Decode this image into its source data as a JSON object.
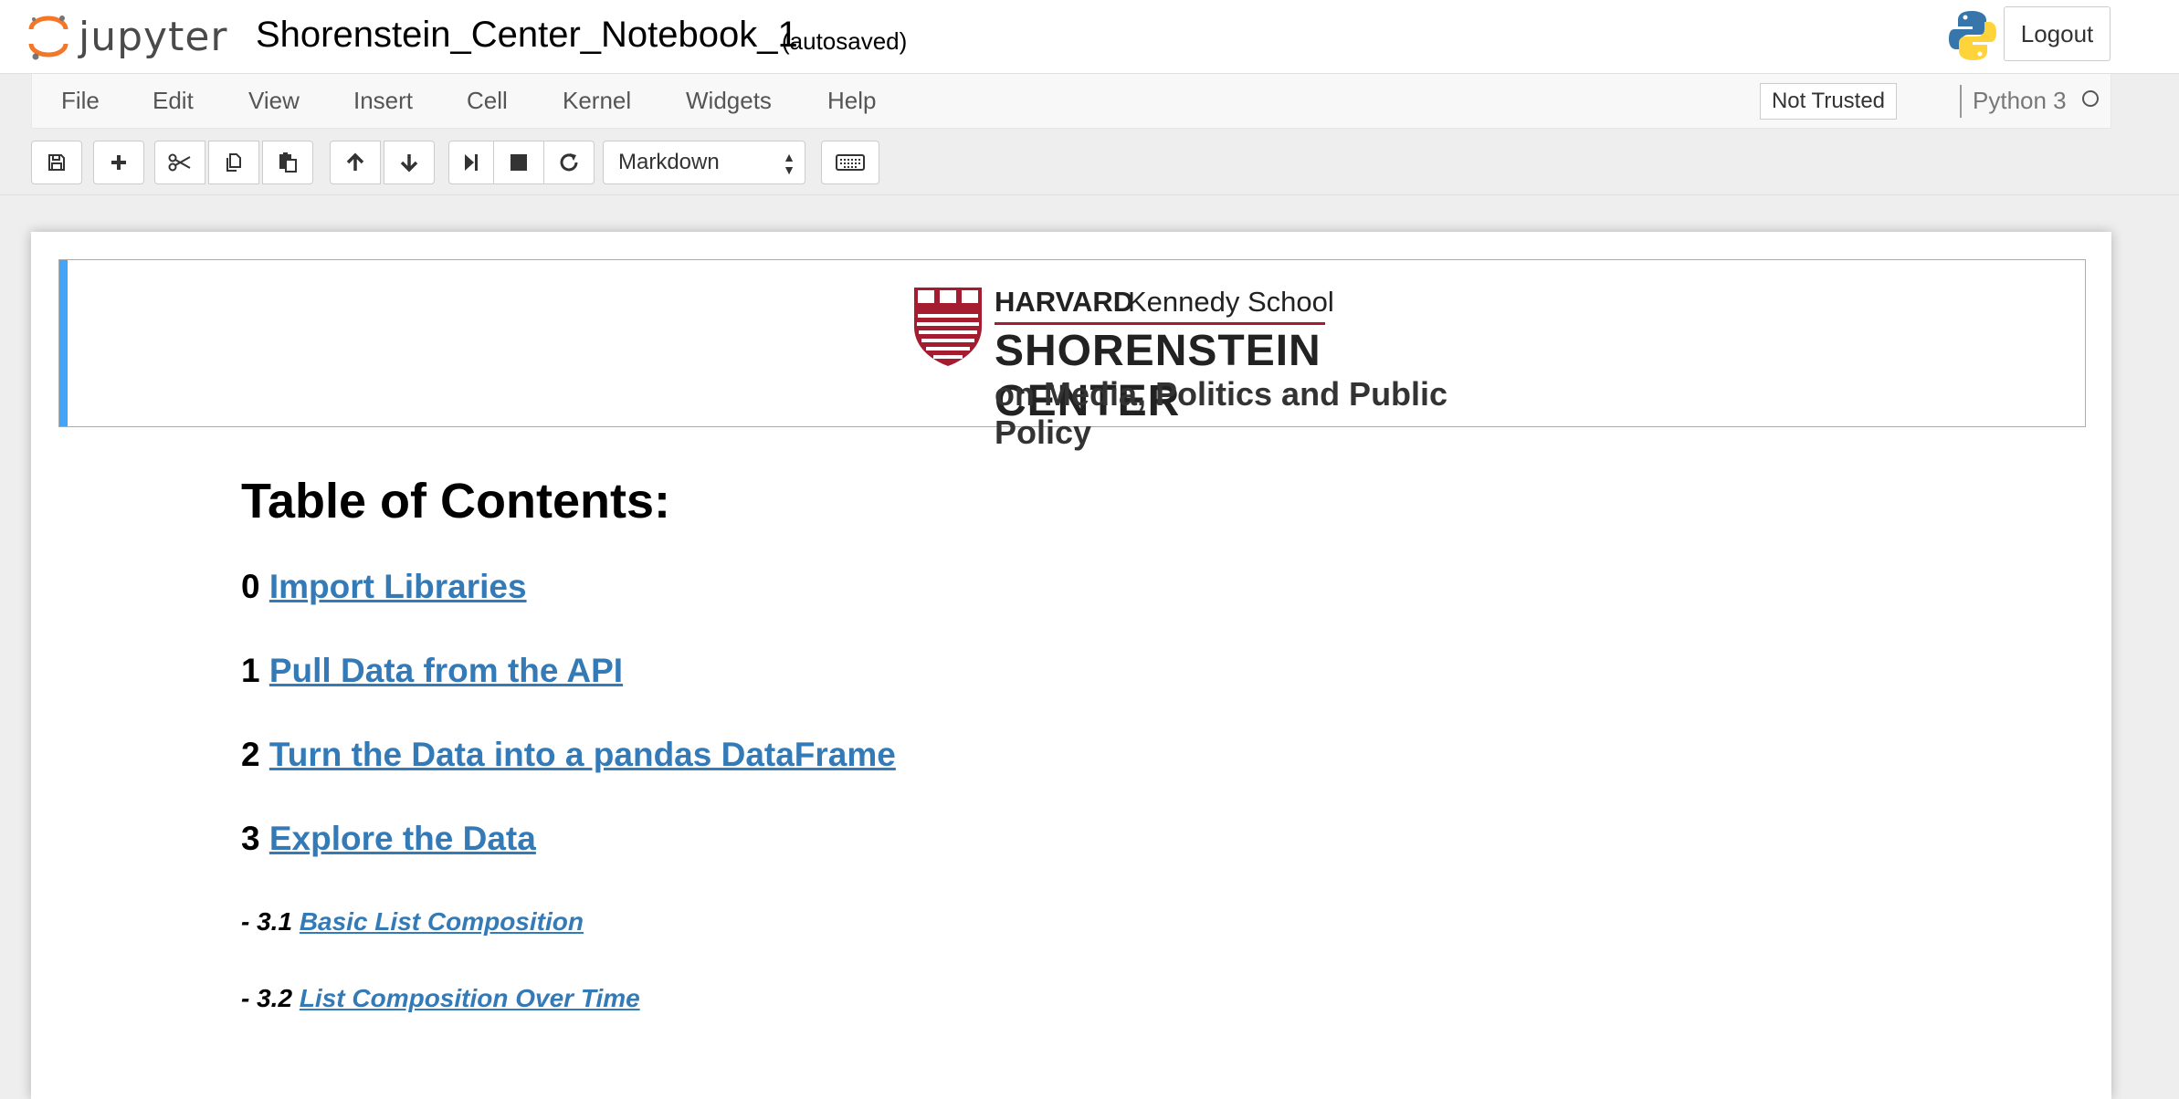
{
  "header": {
    "logo_text": "jupyter",
    "notebook_name": "Shorenstein_Center_Notebook_1",
    "autosave_status": "(autosaved)",
    "logout_label": "Logout"
  },
  "menubar": {
    "items": [
      {
        "label": "File"
      },
      {
        "label": "Edit"
      },
      {
        "label": "View"
      },
      {
        "label": "Insert"
      },
      {
        "label": "Cell"
      },
      {
        "label": "Kernel"
      },
      {
        "label": "Widgets"
      },
      {
        "label": "Help"
      }
    ],
    "trust_label": "Not Trusted",
    "kernel_name": "Python 3"
  },
  "toolbar": {
    "buttons": [
      {
        "icon": "save-icon"
      },
      {
        "icon": "plus-icon"
      },
      {
        "icon": "scissors-icon"
      },
      {
        "icon": "copy-icon"
      },
      {
        "icon": "paste-icon"
      },
      {
        "icon": "arrow-up-icon"
      },
      {
        "icon": "arrow-down-icon"
      },
      {
        "icon": "step-forward-icon"
      },
      {
        "icon": "stop-icon"
      },
      {
        "icon": "restart-icon"
      },
      {
        "icon": "keyboard-icon"
      }
    ],
    "cell_type": "Markdown"
  },
  "banner": {
    "harvard": "HARVARD",
    "kennedy": "Kennedy School",
    "center": "SHORENSTEIN CENTER",
    "subtitle": "on Media, Politics and Public Policy",
    "accent_color": "#a51c30"
  },
  "toc": {
    "title": "Table of Contents:",
    "sections": [
      {
        "num": "0",
        "label": "Import Libraries "
      },
      {
        "num": "1",
        "label": "Pull Data from the API"
      },
      {
        "num": "2",
        "label": "Turn the Data into a pandas DataFrame"
      },
      {
        "num": "3",
        "label": "Explore the Data"
      }
    ],
    "subsections": [
      {
        "num": "- 3.1",
        "label": "Basic List Composition"
      },
      {
        "num": "- 3.2",
        "label": "List Composition Over Time"
      }
    ]
  },
  "colors": {
    "link": "#337ab7",
    "selected_cell_bar": "#42a5f5",
    "jupyter_orange": "#f37726"
  }
}
